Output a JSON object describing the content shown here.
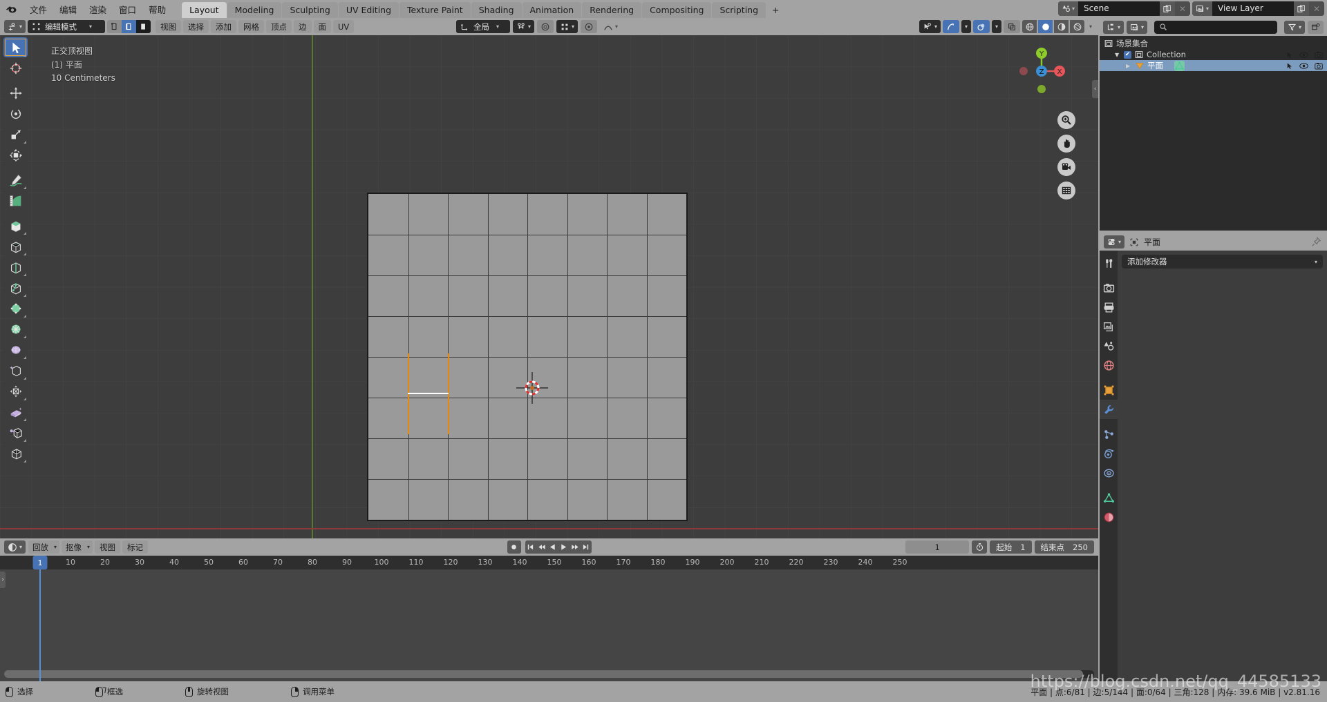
{
  "app": {
    "title": "Blender",
    "version_status": "平面 | 点:6/81 | 边:5/144 | 面:0/64 | 三角:128  | 内存: 39.6 MiB | v2.81.16",
    "watermark": "https://blog.csdn.net/qq_44585133"
  },
  "topbar": {
    "menus": [
      "文件",
      "编辑",
      "渲染",
      "窗口",
      "帮助"
    ],
    "workspace_tabs": [
      {
        "label": "Layout",
        "active": true
      },
      {
        "label": "Modeling",
        "active": false
      },
      {
        "label": "Sculpting",
        "active": false
      },
      {
        "label": "UV Editing",
        "active": false
      },
      {
        "label": "Texture Paint",
        "active": false
      },
      {
        "label": "Shading",
        "active": false
      },
      {
        "label": "Animation",
        "active": false
      },
      {
        "label": "Rendering",
        "active": false
      },
      {
        "label": "Compositing",
        "active": false
      },
      {
        "label": "Scripting",
        "active": false
      },
      {
        "label": "+",
        "active": false
      }
    ],
    "scene_name": "Scene",
    "view_layer_name": "View Layer"
  },
  "viewport_header": {
    "editor_type_icon": "editor-type-icon",
    "mode": "编辑模式",
    "select_modes": [
      "vertex-select-icon",
      "edge-select-icon",
      "face-select-icon"
    ],
    "menus": [
      "视图",
      "选择",
      "添加",
      "网格",
      "顶点",
      "边",
      "面",
      "UV"
    ],
    "transform_orientation": "全局",
    "snap_icon": "magnet-icon",
    "proportional_icon": "proportional-edit-icon",
    "pivot_icon": "pivot-point-icon",
    "falloff_icon": "falloff-curve-icon",
    "right_icons": [
      "visibility-icon",
      "xray-toggle-icon",
      "overlays-icon",
      "shading-wireframe-icon",
      "shading-solid-icon",
      "shading-material-icon",
      "shading-rendered-icon"
    ]
  },
  "viewport": {
    "info_view": "正交顶视图",
    "info_collection": "(1) 平面",
    "info_scale": "10 Centimeters",
    "gizmo_axes": [
      {
        "label": "X",
        "color": "#e05a5a"
      },
      {
        "label": "Y",
        "color": "#8ecc2b"
      },
      {
        "label": "Z",
        "color": "#3b8fd4"
      }
    ],
    "nav_buttons": [
      "zoom-icon",
      "pan-hand-icon",
      "camera-view-icon",
      "toggle-ortho-icon"
    ],
    "mesh": {
      "name": "平面",
      "grid_cols": 8,
      "grid_rows": 8,
      "selected_edge_color": "#ffffff",
      "adjacent_edge_color": "#e8890c"
    },
    "cursor_3d": "3d-cursor-icon"
  },
  "toolbar": {
    "tools": [
      {
        "name": "tweak-select-tool",
        "active": true
      },
      {
        "name": "cursor-tool",
        "active": false
      },
      {
        "name": "move-tool",
        "active": false
      },
      {
        "name": "rotate-tool",
        "active": false
      },
      {
        "name": "scale-tool",
        "active": false
      },
      {
        "name": "transform-tool",
        "active": false
      },
      {
        "name": "annotate-tool",
        "active": false
      },
      {
        "name": "measure-tool",
        "active": false
      },
      {
        "name": "extrude-region-tool",
        "active": false
      },
      {
        "name": "inset-faces-tool",
        "active": false
      },
      {
        "name": "bevel-tool",
        "active": false
      },
      {
        "name": "loop-cut-tool",
        "active": false
      },
      {
        "name": "knife-tool",
        "active": false
      },
      {
        "name": "poly-build-tool",
        "active": false
      },
      {
        "name": "spin-tool",
        "active": false
      },
      {
        "name": "smooth-tool",
        "active": false
      },
      {
        "name": "edge-slide-tool",
        "active": false
      },
      {
        "name": "shrink-fatten-tool",
        "active": false
      },
      {
        "name": "shear-tool",
        "active": false
      },
      {
        "name": "rip-region-tool",
        "active": false
      }
    ]
  },
  "outliner": {
    "display_mode_icon": "outliner-display-mode-icon",
    "filter_id_icon": "filter-id-icon",
    "search_placeholder": "",
    "filter_icon": "funnel-icon",
    "new_collection_icon": "new-collection-icon",
    "rows": [
      {
        "label": "场景集合",
        "icon": "scene-collection-icon",
        "indent": 0,
        "selected": false,
        "has_checkbox": false,
        "has_disclosure": false,
        "show_row_icons": false
      },
      {
        "label": "Collection",
        "icon": "collection-icon",
        "indent": 1,
        "selected": false,
        "has_checkbox": true,
        "has_disclosure": true,
        "show_row_icons": true
      },
      {
        "label": "平面",
        "icon": "mesh-object-icon",
        "indent": 2,
        "selected": true,
        "has_checkbox": false,
        "has_disclosure": true,
        "show_row_icons": true,
        "extra_icon": "mesh-data-icon"
      }
    ],
    "row_icons": [
      "cursor-arrow-icon",
      "eye-icon",
      "camera-icon"
    ]
  },
  "properties": {
    "breadcrumb_icon": "properties-editor-icon",
    "object_icon": "object-data-icon",
    "object_name": "平面",
    "pin_icon": "pin-icon",
    "tabs": [
      {
        "name": "tool-tab",
        "icon": "wrench-screwdriver-icon",
        "active": false
      },
      {
        "name": "render-tab",
        "icon": "camera-back-icon",
        "active": false
      },
      {
        "name": "output-tab",
        "icon": "printer-icon",
        "active": false
      },
      {
        "name": "view-layer-tab",
        "icon": "images-icon",
        "active": false
      },
      {
        "name": "scene-tab",
        "icon": "scene-cone-icon",
        "active": false
      },
      {
        "name": "world-tab",
        "icon": "world-globe-icon",
        "active": false
      },
      {
        "name": "object-tab",
        "icon": "orange-square-icon",
        "active": false
      },
      {
        "name": "modifier-tab",
        "icon": "blue-wrench-icon",
        "active": true
      },
      {
        "name": "particles-tab",
        "icon": "particles-icon",
        "active": false
      },
      {
        "name": "physics-tab",
        "icon": "physics-orbit-icon",
        "active": false
      },
      {
        "name": "constraints-tab",
        "icon": "constraint-icon",
        "active": false
      },
      {
        "name": "data-tab",
        "icon": "green-triangle-data-icon",
        "active": false
      },
      {
        "name": "material-tab",
        "icon": "material-sphere-icon",
        "active": false
      }
    ],
    "add_modifier_label": "添加修改器"
  },
  "timeline": {
    "editor_icon": "timeline-editor-icon",
    "menus": [
      "回放",
      "抠像",
      "视图",
      "标记"
    ],
    "record_icon": "record-icon",
    "play_controls": [
      "jump-start-icon",
      "prev-keyframe-icon",
      "play-reverse-icon",
      "play-icon",
      "next-keyframe-icon",
      "jump-end-icon"
    ],
    "current_frame": "1",
    "timer_icon": "timer-icon",
    "start_label": "起始",
    "start_value": "1",
    "end_label": "结束点",
    "end_value": "250",
    "playhead_frame": "1",
    "ruler_ticks": [
      "10",
      "20",
      "30",
      "40",
      "50",
      "60",
      "70",
      "80",
      "90",
      "100",
      "110",
      "120",
      "130",
      "140",
      "150",
      "160",
      "170",
      "180",
      "190",
      "200",
      "210",
      "220",
      "230",
      "240",
      "250"
    ]
  },
  "statusbar": {
    "hints": [
      {
        "mouse": "left",
        "label": "选择"
      },
      {
        "mouse": "left-drag",
        "label": "框选"
      },
      {
        "mouse": "middle",
        "label": "旋转视图"
      },
      {
        "mouse": "right",
        "label": "调用菜单"
      }
    ]
  }
}
